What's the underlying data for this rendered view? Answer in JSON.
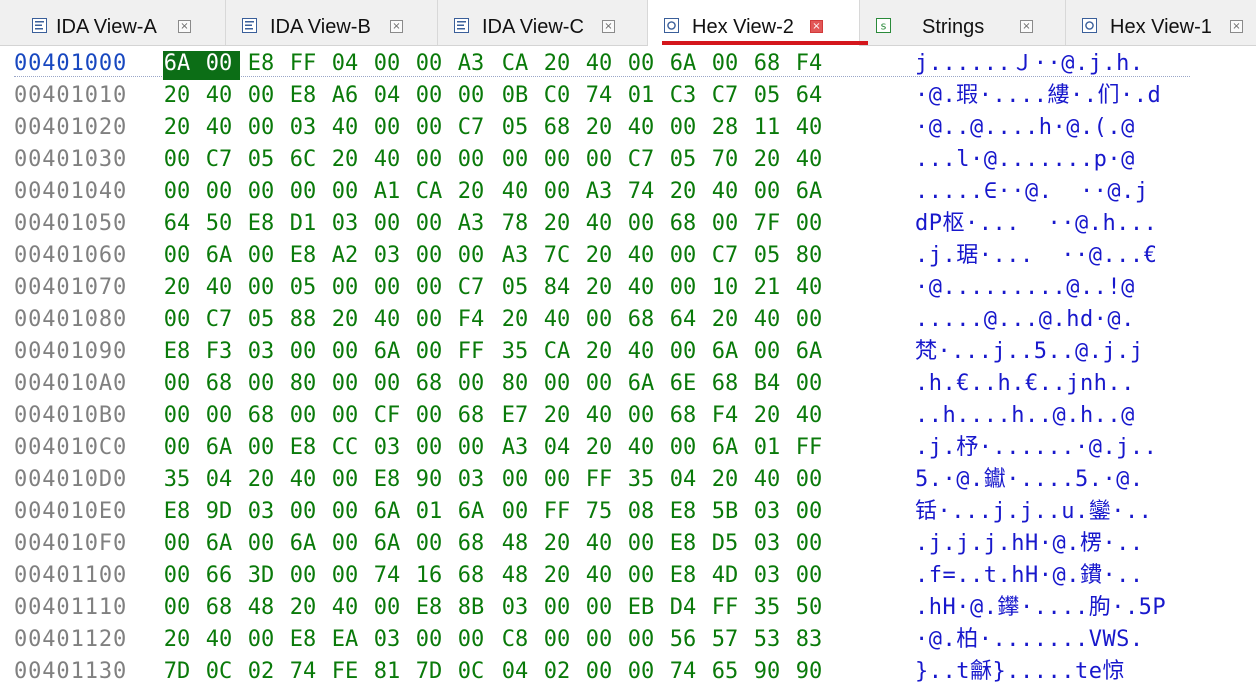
{
  "tabs": [
    {
      "label": "IDA View-A",
      "icon": "disassembly-view-icon",
      "active": false
    },
    {
      "label": "IDA View-B",
      "icon": "disassembly-view-icon",
      "active": false
    },
    {
      "label": "IDA View-C",
      "icon": "disassembly-view-icon",
      "active": false
    },
    {
      "label": "Hex View-2",
      "icon": "hex-view-icon",
      "active": true
    },
    {
      "label": "Strings",
      "icon": "strings-icon",
      "active": false
    },
    {
      "label": "Hex View-1",
      "icon": "hex-view-icon",
      "active": false
    }
  ],
  "close_glyph": "×",
  "colors": {
    "address": "#808080",
    "address_current": "#1848c0",
    "hex_bytes": "#0a7a0a",
    "ascii": "#1818cc",
    "selection": "#0c6e16",
    "active_tab_underline": "#d4161c"
  },
  "hex": {
    "rows": [
      {
        "addr": "00401000",
        "bytes": [
          "6A",
          "00",
          "E8",
          "FF",
          "04",
          "00",
          "00",
          "A3",
          "CA",
          "20",
          "40",
          "00",
          "6A",
          "00",
          "68",
          "F4"
        ],
        "ascii": "j......Ｊ··@.j.h."
      },
      {
        "addr": "00401010",
        "bytes": [
          "20",
          "40",
          "00",
          "E8",
          "A6",
          "04",
          "00",
          "00",
          "0B",
          "C0",
          "74",
          "01",
          "C3",
          "C7",
          "05",
          "64"
        ],
        "ascii": "·@.瑕·....縷·.们·.d"
      },
      {
        "addr": "00401020",
        "bytes": [
          "20",
          "40",
          "00",
          "03",
          "40",
          "00",
          "00",
          "C7",
          "05",
          "68",
          "20",
          "40",
          "00",
          "28",
          "11",
          "40"
        ],
        "ascii": "·@..@....h·@.(.@"
      },
      {
        "addr": "00401030",
        "bytes": [
          "00",
          "C7",
          "05",
          "6C",
          "20",
          "40",
          "00",
          "00",
          "00",
          "00",
          "00",
          "C7",
          "05",
          "70",
          "20",
          "40"
        ],
        "ascii": "...l·@.......p·@"
      },
      {
        "addr": "00401040",
        "bytes": [
          "00",
          "00",
          "00",
          "00",
          "00",
          "A1",
          "CA",
          "20",
          "40",
          "00",
          "A3",
          "74",
          "20",
          "40",
          "00",
          "6A"
        ],
        "ascii": ".....∈··@.  ··@.j"
      },
      {
        "addr": "00401050",
        "bytes": [
          "64",
          "50",
          "E8",
          "D1",
          "03",
          "00",
          "00",
          "A3",
          "78",
          "20",
          "40",
          "00",
          "68",
          "00",
          "7F",
          "00"
        ],
        "ascii": "dP枢·...  ··@.h..."
      },
      {
        "addr": "00401060",
        "bytes": [
          "00",
          "6A",
          "00",
          "E8",
          "A2",
          "03",
          "00",
          "00",
          "A3",
          "7C",
          "20",
          "40",
          "00",
          "C7",
          "05",
          "80"
        ],
        "ascii": ".j.琚·...  ··@...€"
      },
      {
        "addr": "00401070",
        "bytes": [
          "20",
          "40",
          "00",
          "05",
          "00",
          "00",
          "00",
          "C7",
          "05",
          "84",
          "20",
          "40",
          "00",
          "10",
          "21",
          "40"
        ],
        "ascii": "·@.........@..!@"
      },
      {
        "addr": "00401080",
        "bytes": [
          "00",
          "C7",
          "05",
          "88",
          "20",
          "40",
          "00",
          "F4",
          "20",
          "40",
          "00",
          "68",
          "64",
          "20",
          "40",
          "00"
        ],
        "ascii": ".....@...@.hd·@."
      },
      {
        "addr": "00401090",
        "bytes": [
          "E8",
          "F3",
          "03",
          "00",
          "00",
          "6A",
          "00",
          "FF",
          "35",
          "CA",
          "20",
          "40",
          "00",
          "6A",
          "00",
          "6A"
        ],
        "ascii": "梵·...j..5..@.j.j"
      },
      {
        "addr": "004010A0",
        "bytes": [
          "00",
          "68",
          "00",
          "80",
          "00",
          "00",
          "68",
          "00",
          "80",
          "00",
          "00",
          "6A",
          "6E",
          "68",
          "B4",
          "00"
        ],
        "ascii": ".h.€..h.€..jnh.."
      },
      {
        "addr": "004010B0",
        "bytes": [
          "00",
          "00",
          "68",
          "00",
          "00",
          "CF",
          "00",
          "68",
          "E7",
          "20",
          "40",
          "00",
          "68",
          "F4",
          "20",
          "40"
        ],
        "ascii": "..h....h..@.h..@"
      },
      {
        "addr": "004010C0",
        "bytes": [
          "00",
          "6A",
          "00",
          "E8",
          "CC",
          "03",
          "00",
          "00",
          "A3",
          "04",
          "20",
          "40",
          "00",
          "6A",
          "01",
          "FF"
        ],
        "ascii": ".j.杼·......·@.j.."
      },
      {
        "addr": "004010D0",
        "bytes": [
          "35",
          "04",
          "20",
          "40",
          "00",
          "E8",
          "90",
          "03",
          "00",
          "00",
          "FF",
          "35",
          "04",
          "20",
          "40",
          "00"
        ],
        "ascii": "5.·@.钀·....5.·@."
      },
      {
        "addr": "004010E0",
        "bytes": [
          "E8",
          "9D",
          "03",
          "00",
          "00",
          "6A",
          "01",
          "6A",
          "00",
          "FF",
          "75",
          "08",
          "E8",
          "5B",
          "03",
          "00"
        ],
        "ascii": "铦·...j.j..u.鑾·.."
      },
      {
        "addr": "004010F0",
        "bytes": [
          "00",
          "6A",
          "00",
          "6A",
          "00",
          "6A",
          "00",
          "68",
          "48",
          "20",
          "40",
          "00",
          "E8",
          "D5",
          "03",
          "00"
        ],
        "ascii": ".j.j.j.hH·@.楞·.."
      },
      {
        "addr": "00401100",
        "bytes": [
          "00",
          "66",
          "3D",
          "00",
          "00",
          "74",
          "16",
          "68",
          "48",
          "20",
          "40",
          "00",
          "E8",
          "4D",
          "03",
          "00"
        ],
        "ascii": ".f=..t.hH·@.鐨·.."
      },
      {
        "addr": "00401110",
        "bytes": [
          "00",
          "68",
          "48",
          "20",
          "40",
          "00",
          "E8",
          "8B",
          "03",
          "00",
          "00",
          "EB",
          "D4",
          "FF",
          "35",
          "50"
        ],
        "ascii": ".hH·@.鑻·....朐·.5P"
      },
      {
        "addr": "00401120",
        "bytes": [
          "20",
          "40",
          "00",
          "E8",
          "EA",
          "03",
          "00",
          "00",
          "C8",
          "00",
          "00",
          "00",
          "56",
          "57",
          "53",
          "83"
        ],
        "ascii": "·@.柏·.......VWS."
      },
      {
        "addr": "00401130",
        "bytes": [
          "7D",
          "0C",
          "02",
          "74",
          "FE",
          "81",
          "7D",
          "0C",
          "04",
          "02",
          "00",
          "00",
          "74",
          "65",
          "90",
          "90"
        ],
        "ascii": "}..t龢}.....te惊"
      }
    ]
  }
}
